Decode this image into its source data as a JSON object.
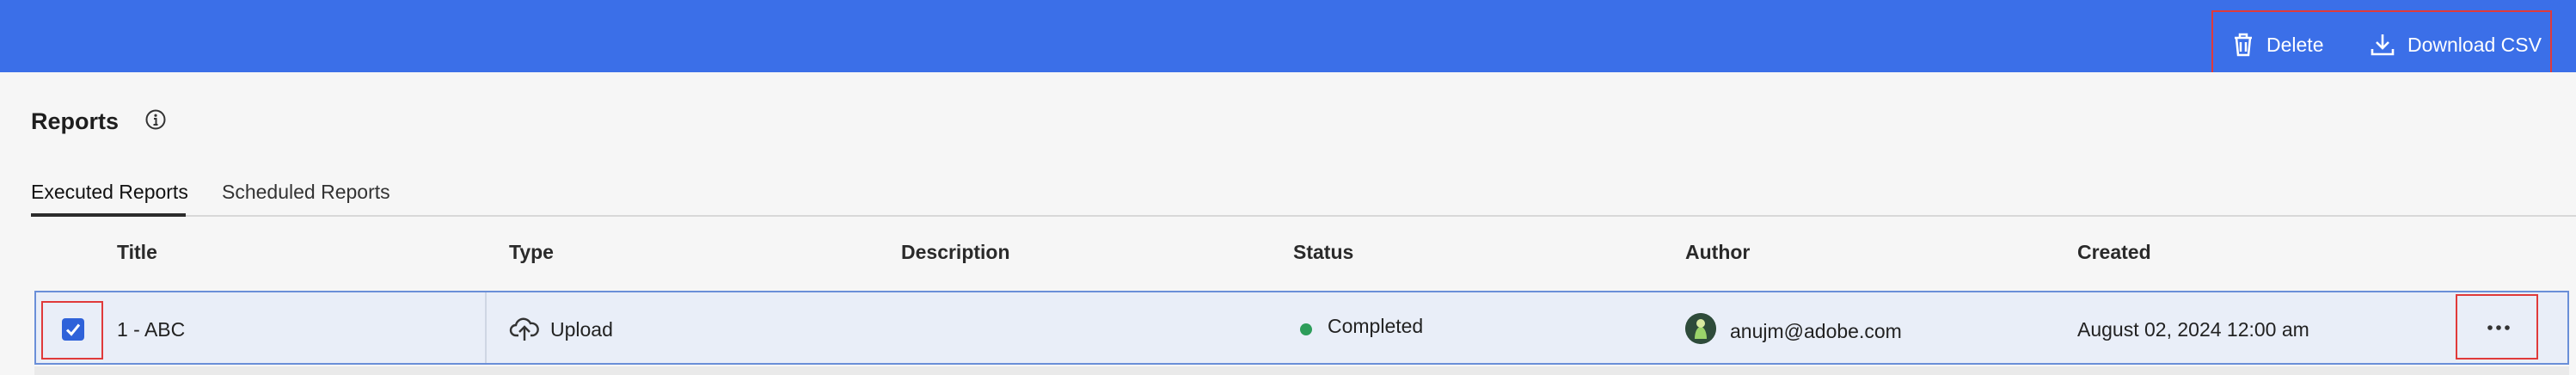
{
  "toolbar": {
    "delete_label": "Delete",
    "download_label": "Download CSV",
    "background_color": "#3b6fe8",
    "highlight_color": "#e03a3a"
  },
  "page": {
    "title": "Reports",
    "info_icon": "info-icon"
  },
  "tabs": [
    {
      "label": "Executed Reports",
      "active": true
    },
    {
      "label": "Scheduled Reports",
      "active": false
    }
  ],
  "table": {
    "columns": [
      "Title",
      "Type",
      "Description",
      "Status",
      "Author",
      "Created"
    ],
    "rows": [
      {
        "selected": true,
        "title": "1 - ABC",
        "type": "Upload",
        "type_icon": "cloud-upload-icon",
        "description": "",
        "status": "Completed",
        "status_color": "#2d9d5a",
        "author": "anujm@adobe.com",
        "created": "August 02, 2024 12:00 am",
        "more_icon": "more-icon"
      }
    ]
  }
}
